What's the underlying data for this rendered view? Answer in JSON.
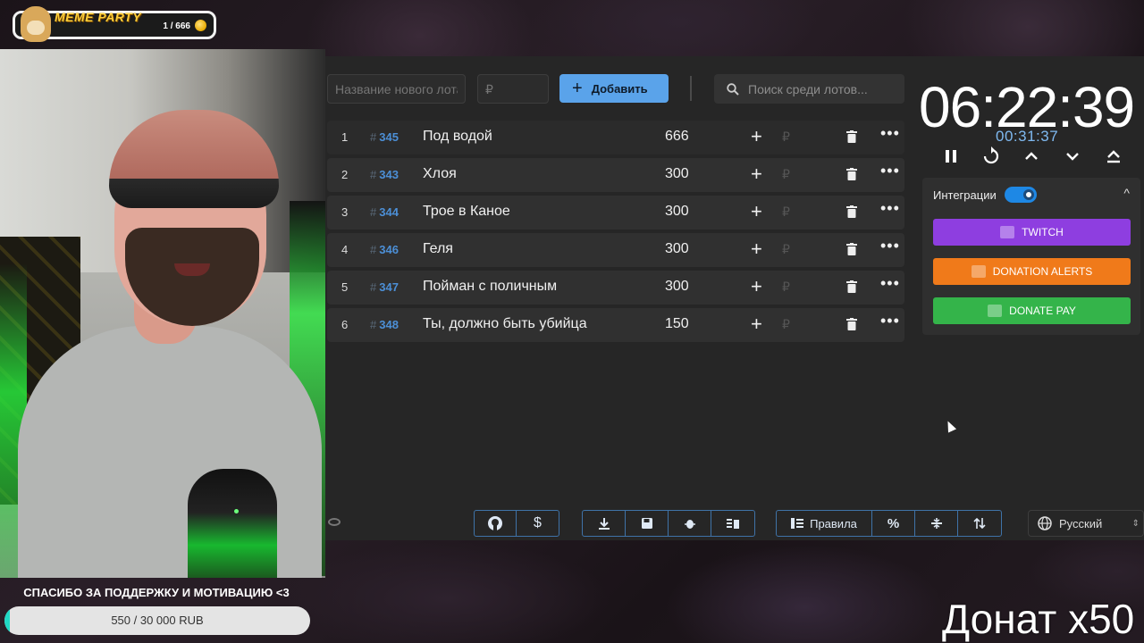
{
  "overlay": {
    "badge_title": "MEME PARTY",
    "badge_count": "1 / 666",
    "thanks_text": "СПАСИБО ЗА ПОДДЕРЖКУ И МОТИВАЦИЮ <3",
    "goal_text": "550 / 30 000 RUB",
    "goal_progress": 0.0183,
    "donat_text": "Донат x50"
  },
  "toolbar": {
    "new_lot_placeholder": "Название нового лота",
    "amount_placeholder": "₽",
    "add_label": "Добавить",
    "search_placeholder": "Поиск среди лотов..."
  },
  "lots": [
    {
      "num": "1",
      "id": "345",
      "name": "Под водой",
      "amount": "666"
    },
    {
      "num": "2",
      "id": "343",
      "name": "Хлоя",
      "amount": "300"
    },
    {
      "num": "3",
      "id": "344",
      "name": "Трое в Каное",
      "amount": "300"
    },
    {
      "num": "4",
      "id": "346",
      "name": "Геля",
      "amount": "300"
    },
    {
      "num": "5",
      "id": "347",
      "name": "Пойман с поличным",
      "amount": "300"
    },
    {
      "num": "6",
      "id": "348",
      "name": "Ты, должно быть убийца",
      "amount": "150"
    }
  ],
  "timer": {
    "main": "06:22:39",
    "sub": "00:31:37",
    "controls": [
      "pause-icon",
      "reset-icon",
      "chevron-up-icon",
      "chevron-down-icon",
      "eject-icon"
    ]
  },
  "integrations": {
    "label": "Интеграции",
    "enabled": true,
    "buttons": [
      {
        "label": "TWITCH",
        "color": "#8e3ee0"
      },
      {
        "label": "DONATION ALERTS",
        "color": "#f07a1a"
      },
      {
        "label": "DONATE PAY",
        "color": "#34b44a"
      }
    ]
  },
  "bottom": {
    "rules_label": "Правила",
    "language": "Русский",
    "icons": [
      "github-icon",
      "dollar-icon",
      "download-icon",
      "save-icon",
      "bug-icon",
      "clear-icon",
      "rules-icon",
      "percent-icon",
      "split-icon",
      "sort-icon",
      "globe-icon"
    ]
  },
  "colors": {
    "accent": "#5aa3ea",
    "id_color": "#4c8fd6",
    "panel": "#262626"
  }
}
